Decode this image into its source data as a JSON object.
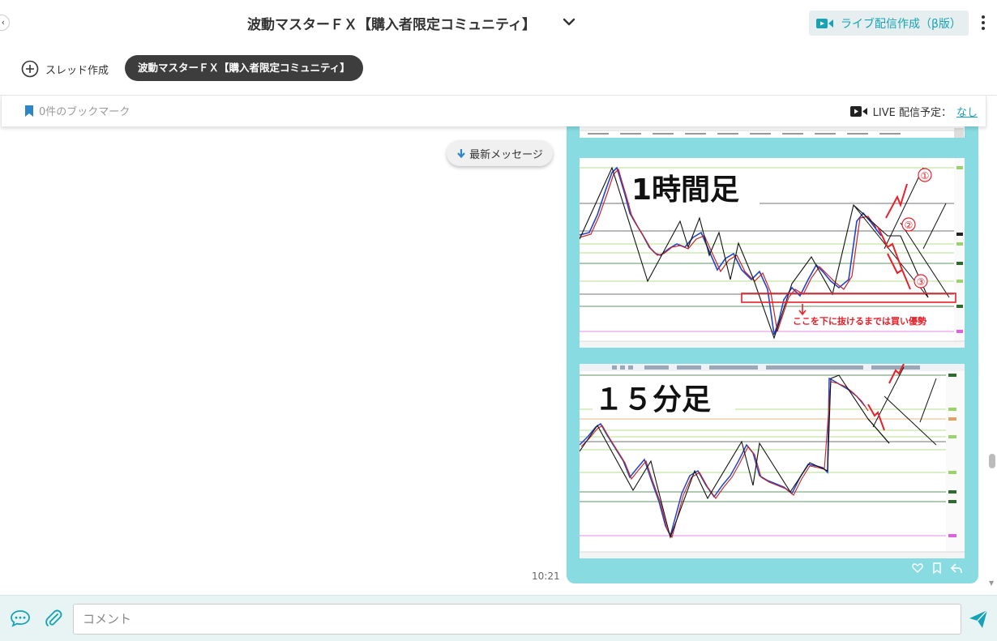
{
  "header": {
    "title": "波動マスターＦＸ【購入者限定コミュニティ】",
    "live_button_label": "ライブ配信作成（β版）"
  },
  "thread_bar": {
    "new_thread_label": "スレッド作成",
    "active_thread": "波動マスターＦＸ【購入者限定コミュニティ】"
  },
  "bookmark_bar": {
    "bookmark_count_text": "0件のブックマーク",
    "live_schedule_label": "LIVE 配信予定：",
    "live_schedule_value": "なし"
  },
  "chat": {
    "latest_button": "最新メッセージ",
    "message": {
      "time": "10:21",
      "image1": {
        "caption": "1時間足",
        "annotation": "ここを下に抜けるまでは買い優勢",
        "markers": [
          "①",
          "②",
          "③"
        ]
      },
      "image2": {
        "caption": "１５分足"
      }
    }
  },
  "composer": {
    "placeholder": "コメント"
  },
  "colors": {
    "accent": "#17a3b5",
    "bubble": "#88dbe0",
    "pill": "#3d3d3d",
    "annotation_red": "#e8202a"
  }
}
